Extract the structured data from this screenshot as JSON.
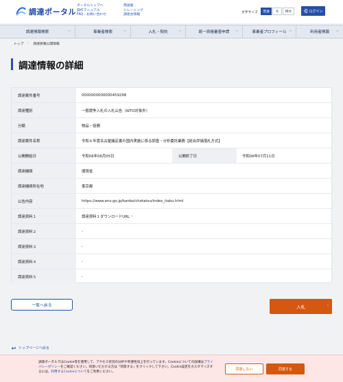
{
  "header": {
    "logo_text": "調達ポータル",
    "links_col1": [
      "ポータルトップへ",
      "操作マニュアル",
      "FAQ・お問い合わせ"
    ],
    "links_col2": [
      "用語集",
      "トレーニング",
      "調達会情報"
    ],
    "font_size_label": "文字サイズ",
    "font_sizes": [
      "普通",
      "大",
      "特大"
    ],
    "login_label": "ログイン"
  },
  "nav": {
    "items": [
      "調達情報検索",
      "事業者検索",
      "入札・契約",
      "統一資格審査申請",
      "事業者プロフィール",
      "利用者情報"
    ]
  },
  "breadcrumb": [
    "トップ",
    "調達情報公開情報"
  ],
  "page_title": "調達情報の詳細",
  "details": {
    "case_number_label": "調達案件番号",
    "case_number": "0000000000000459298",
    "type_label": "調達種別",
    "type": "一般競争入札の入札公告（WTO対象外）",
    "category_label": "分類",
    "category": "物品・役務",
    "name_label": "調達案件名称",
    "name": "令和６年度名古屋議定書の国内実施に係る調査・分析委託業務【総合評価落札方式】",
    "start_label": "公開開始日",
    "start": "令和06年06月05日",
    "end_label": "公開終了日",
    "end": "令和06年07月11日",
    "agency_label": "調達機関",
    "agency": "環境省",
    "location_label": "調達機関所在地",
    "location": "東京都",
    "notice_label": "公告内容",
    "notice": "https://www.env.go.jp/kanbo/chotatsu/index_itaku.html",
    "doc1_label": "調達資料１",
    "doc1": "調達資料１ダウンロードURL",
    "doc2_label": "調達資料２",
    "doc2": "-",
    "doc3_label": "調達資料３",
    "doc3": "-",
    "doc4_label": "調達資料４",
    "doc4": "-",
    "doc5_label": "調達資料５",
    "doc5": "-"
  },
  "buttons": {
    "back": "一覧へ戻る",
    "bid": "入札"
  },
  "toplink": "トップページへ戻る",
  "cookie": {
    "text_1": "調達ポータルではCookie等を使用して、アクセス状況の分析や利便性向上を行っています。Cookieについての詳細は",
    "privacy_link": "プライバシーポリシー",
    "text_2": "をご確認ください。同意いただける方は「同意する」をクリックして下さい。Cookie設定をカスタマイズするには、",
    "settings_link": "利用するCookieについて",
    "text_3": "をご利用ください。",
    "reject": "同意しない",
    "accept": "同意する"
  }
}
